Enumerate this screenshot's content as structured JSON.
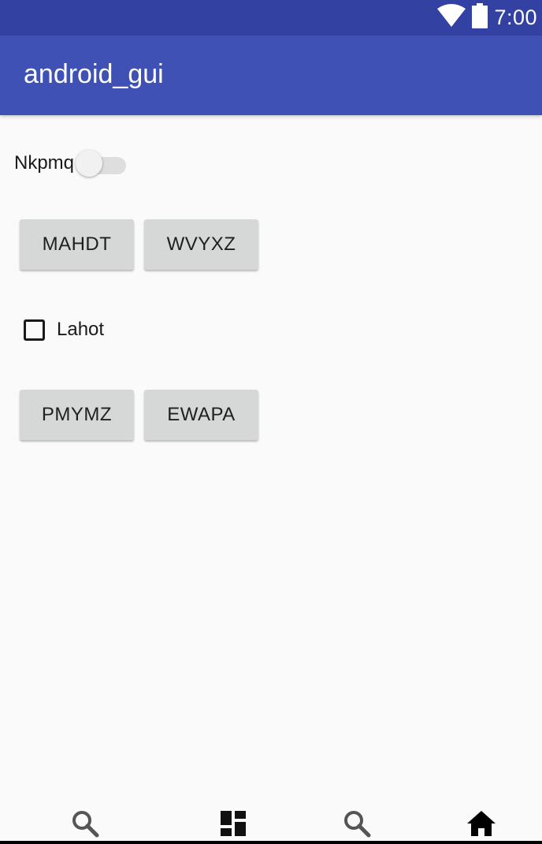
{
  "status_bar": {
    "time": "7:00",
    "icons": [
      "wifi-icon",
      "battery-icon"
    ],
    "background": "#3341a3"
  },
  "app_bar": {
    "title": "android_gui",
    "background": "#3f51b5"
  },
  "switch": {
    "label": "Nkpmq",
    "checked": false
  },
  "buttons_row1": [
    "MAHDT",
    "WVYXZ"
  ],
  "checkbox": {
    "label": "Lahot",
    "checked": false
  },
  "buttons_row2": [
    "PMYMZ",
    "EWAPA"
  ],
  "bottom_nav": {
    "items": [
      {
        "icon": "search-icon"
      },
      {
        "icon": "dashboard-icon"
      },
      {
        "icon": "search-icon"
      },
      {
        "icon": "home-icon"
      }
    ]
  }
}
